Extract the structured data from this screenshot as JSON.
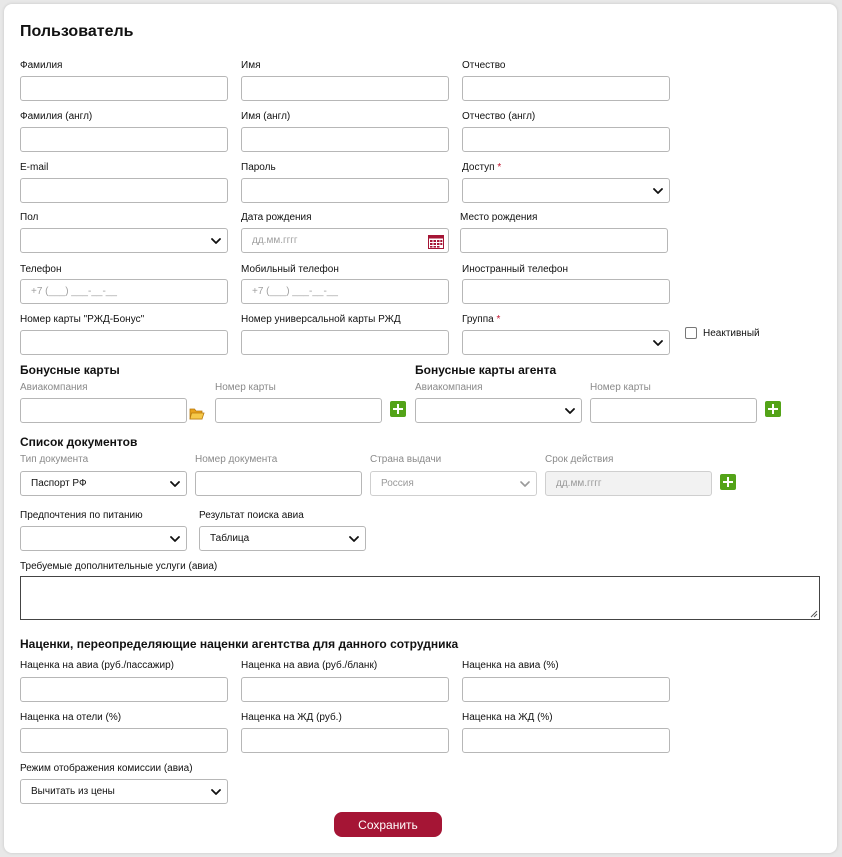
{
  "title": "Пользователь",
  "required_mark": "*",
  "fields": {
    "last_name": {
      "label": "Фамилия",
      "value": ""
    },
    "first_name": {
      "label": "Имя",
      "value": ""
    },
    "middle_name": {
      "label": "Отчество",
      "value": ""
    },
    "last_name_en": {
      "label": "Фамилия (англ)",
      "value": ""
    },
    "first_name_en": {
      "label": "Имя (англ)",
      "value": ""
    },
    "middle_name_en": {
      "label": "Отчество (англ)",
      "value": ""
    },
    "email": {
      "label": "E-mail",
      "value": ""
    },
    "password": {
      "label": "Пароль",
      "value": ""
    },
    "access": {
      "label": "Доступ",
      "value": ""
    },
    "gender": {
      "label": "Пол",
      "value": ""
    },
    "birth_date": {
      "label": "Дата рождения",
      "placeholder": "дд.мм.гггг"
    },
    "birth_place": {
      "label": "Место рождения",
      "value": ""
    },
    "phone": {
      "label": "Телефон",
      "placeholder": "+7 (___) ___-__-__"
    },
    "mobile_phone": {
      "label": "Мобильный телефон",
      "placeholder": "+7 (___) ___-__-__"
    },
    "foreign_phone": {
      "label": "Иностранный телефон",
      "value": ""
    },
    "rzd_bonus": {
      "label": "Номер карты \"РЖД-Бонус\"",
      "value": ""
    },
    "rzd_universal": {
      "label": "Номер универсальной карты РЖД",
      "value": ""
    },
    "group": {
      "label": "Группа",
      "value": ""
    },
    "inactive": {
      "label": "Неактивный",
      "checked": false
    }
  },
  "bonus_cards": {
    "title": "Бонусные карты",
    "airline_label": "Авиакомпания",
    "card_number_label": "Номер карты"
  },
  "agent_bonus_cards": {
    "title": "Бонусные карты агента",
    "airline_label": "Авиакомпания",
    "card_number_label": "Номер карты"
  },
  "documents": {
    "title": "Список документов",
    "type_label": "Тип документа",
    "type_value": "Паспорт РФ",
    "number_label": "Номер документа",
    "country_label": "Страна выдачи",
    "country_value": "Россия",
    "expiry_label": "Срок действия",
    "expiry_placeholder": "дд.мм.гггг"
  },
  "preferences": {
    "meal_label": "Предпочтения по питанию",
    "meal_value": "",
    "search_result_label": "Результат поиска авиа",
    "search_result_value": "Таблица",
    "extra_services_label": "Требуемые дополнительные услуги (авиа)"
  },
  "markups": {
    "title": "Наценки, переопределяющие наценки агентства для данного сотрудника",
    "air_pax_label": "Наценка на авиа (руб./пассажир)",
    "air_blank_label": "Наценка на авиа (руб./бланк)",
    "air_pct_label": "Наценка на авиа (%)",
    "hotel_pct_label": "Наценка на отели (%)",
    "rail_rub_label": "Наценка на ЖД (руб.)",
    "rail_pct_label": "Наценка на ЖД (%)",
    "commission_mode_label": "Режим отображения комиссии (авиа)",
    "commission_mode_value": "Вычитать из цены"
  },
  "save_label": "Сохранить",
  "colors": {
    "accent": "#a51535",
    "add_green": "#53a318",
    "required": "#c0142f"
  }
}
